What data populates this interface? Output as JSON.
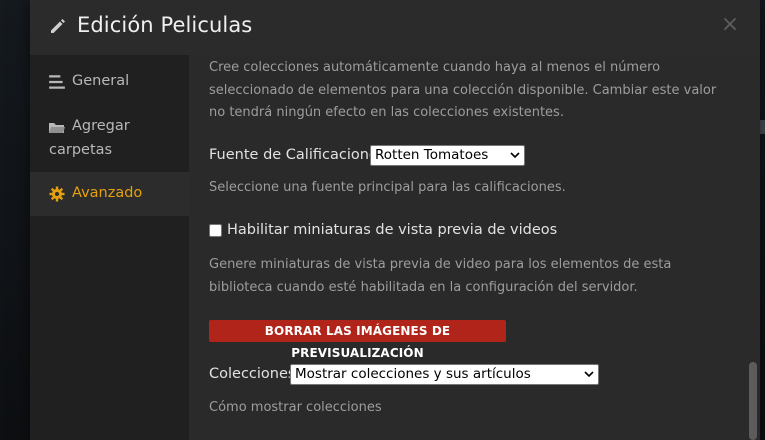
{
  "modal": {
    "title": "Edición Peliculas",
    "title_icon": "pencil-icon",
    "close_glyph": "×"
  },
  "sidebar": {
    "items": [
      {
        "label": "General",
        "icon": "list-icon",
        "active": false
      },
      {
        "label_line1": "Agregar",
        "label_line2": "carpetas",
        "icon": "folder-icon",
        "active": false
      },
      {
        "label": "Avanzado",
        "icon": "gear-icon",
        "active": true
      }
    ]
  },
  "content": {
    "auto_collections_help": "Cree colecciones automáticamente cuando haya al menos el número seleccionado de elementos para una colección disponible. Cambiar este valor no tendrá ningún efecto en las colecciones existentes.",
    "ratings": {
      "label": "Fuente de Calificaciones",
      "selected": "Rotten Tomatoes",
      "help": "Seleccione una fuente principal para las calificaciones."
    },
    "thumbnails": {
      "label": "Habilitar miniaturas de vista previa de videos",
      "checked": false,
      "help": "Genere miniaturas de vista previa de video para los elementos de esta biblioteca cuando esté habilitada en la configuración del servidor."
    },
    "clear_previews_button": "BORRAR LAS IMÁGENES DE PREVISUALIZACIÓN",
    "collections": {
      "label": "Colecciones",
      "selected": "Mostrar colecciones y sus artículos",
      "help": "Cómo mostrar colecciones"
    }
  },
  "colors": {
    "accent": "#e5a00d",
    "danger": "#b0241a",
    "panel": "#2a2a2a",
    "sidebar": "#202020",
    "header": "#2b2b2b"
  }
}
